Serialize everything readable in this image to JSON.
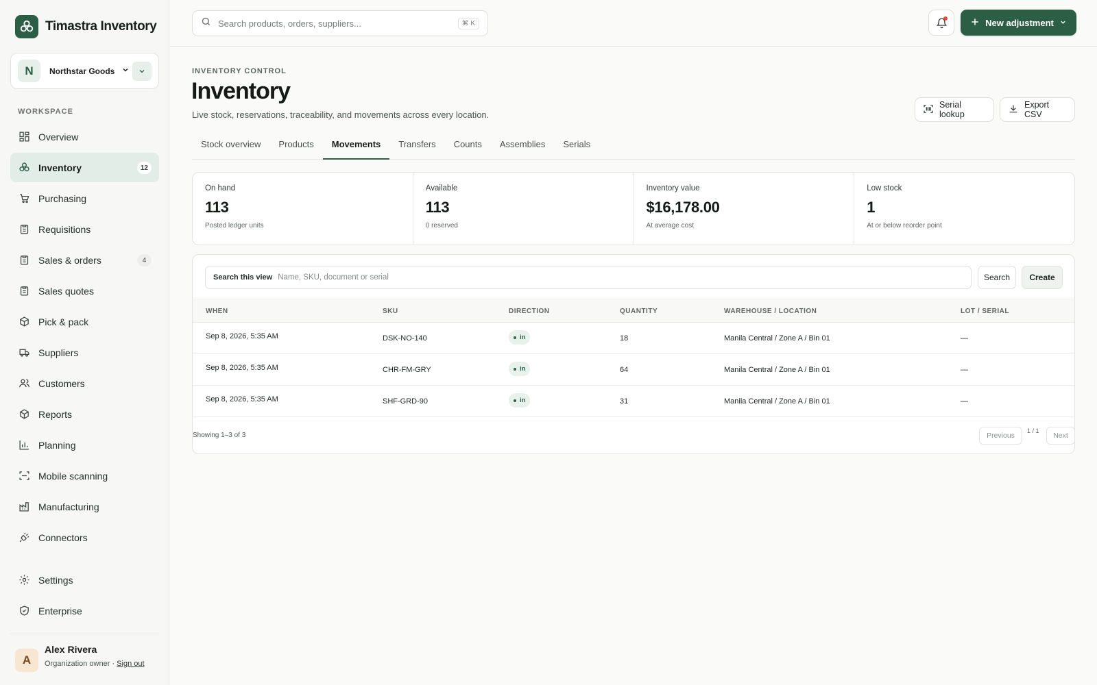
{
  "app": {
    "name": "Timastra Inventory"
  },
  "org": {
    "initial": "N",
    "name": "Northstar Goods"
  },
  "sidebar": {
    "section_label": "WORKSPACE",
    "items": [
      {
        "label": "Overview",
        "icon": "grid-icon"
      },
      {
        "label": "Inventory",
        "icon": "inventory-icon",
        "badge": "12",
        "active": true
      },
      {
        "label": "Purchasing",
        "icon": "cart-icon"
      },
      {
        "label": "Requisitions",
        "icon": "clipboard-icon"
      },
      {
        "label": "Sales & orders",
        "icon": "clipboard-icon",
        "badge": "4"
      },
      {
        "label": "Sales quotes",
        "icon": "clipboard-icon"
      },
      {
        "label": "Pick & pack",
        "icon": "package-icon"
      },
      {
        "label": "Suppliers",
        "icon": "truck-icon"
      },
      {
        "label": "Customers",
        "icon": "users-icon"
      },
      {
        "label": "Reports",
        "icon": "package-icon"
      },
      {
        "label": "Planning",
        "icon": "bar-chart-icon"
      },
      {
        "label": "Mobile scanning",
        "icon": "scan-icon"
      },
      {
        "label": "Manufacturing",
        "icon": "factory-icon"
      },
      {
        "label": "Connectors",
        "icon": "plug-icon"
      }
    ],
    "bottom_items": [
      {
        "label": "Settings",
        "icon": "gear-icon"
      },
      {
        "label": "Enterprise",
        "icon": "shield-icon"
      }
    ]
  },
  "user": {
    "initial": "A",
    "name": "Alex Rivera",
    "role": "Organization owner · ",
    "signout": "Sign out"
  },
  "topbar": {
    "search_placeholder": "Search products, orders, suppliers...",
    "shortcut": "⌘ K",
    "primary_label": "New adjustment"
  },
  "page": {
    "eyebrow": "INVENTORY CONTROL",
    "title": "Inventory",
    "subtitle": "Live stock, reservations, traceability, and movements across every location.",
    "serial_lookup": "Serial lookup",
    "export_csv": "Export CSV"
  },
  "tabs": [
    "Stock overview",
    "Products",
    "Movements",
    "Transfers",
    "Counts",
    "Assemblies",
    "Serials"
  ],
  "active_tab": "Movements",
  "stats": [
    {
      "label": "On hand",
      "value": "113",
      "note": "Posted ledger units"
    },
    {
      "label": "Available",
      "value": "113",
      "note": "0 reserved"
    },
    {
      "label": "Inventory value",
      "value": "$16,178.00",
      "note": "At average cost"
    },
    {
      "label": "Low stock",
      "value": "1",
      "note": "At or below reorder point"
    }
  ],
  "filter": {
    "label": "Search this view",
    "placeholder": "Name, SKU, document or serial",
    "search_label": "Search",
    "create_label": "Create"
  },
  "table": {
    "columns": [
      "WHEN",
      "SKU",
      "DIRECTION",
      "QUANTITY",
      "WAREHOUSE / LOCATION",
      "LOT / SERIAL"
    ],
    "rows": [
      {
        "when": "Sep 8, 2026, 5:35 AM",
        "sku": "DSK-NO-140",
        "direction": "in",
        "quantity": "18",
        "location": "Manila Central / Zone A / Bin 01",
        "lot": "—"
      },
      {
        "when": "Sep 8, 2026, 5:35 AM",
        "sku": "CHR-FM-GRY",
        "direction": "in",
        "quantity": "64",
        "location": "Manila Central / Zone A / Bin 01",
        "lot": "—"
      },
      {
        "when": "Sep 8, 2026, 5:35 AM",
        "sku": "SHF-GRD-90",
        "direction": "in",
        "quantity": "31",
        "location": "Manila Central / Zone A / Bin 01",
        "lot": "—"
      }
    ]
  },
  "pagination": {
    "summary": "Showing 1–3 of 3",
    "previous": "Previous",
    "page": "1 / 1",
    "next": "Next"
  },
  "colors": {
    "accent": "#2b5e44",
    "accent_soft": "#e3ede7",
    "notification": "#e24c3b"
  }
}
